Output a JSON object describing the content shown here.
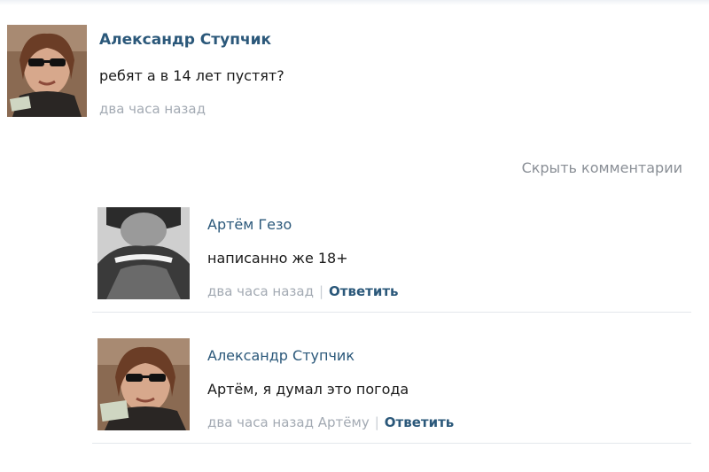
{
  "post": {
    "author": "Александр Ступчик",
    "text": "ребят а в 14 лет пустят?",
    "time": "два часа назад"
  },
  "hide_comments_label": "Скрыть комментарии",
  "replies": [
    {
      "author": "Артём Гезо",
      "text": "написанно же 18+",
      "time": "два часа назад",
      "reply_to": "",
      "answer_label": "Ответить"
    },
    {
      "author": "Александр Ступчик",
      "text": "Артём, я думал это погода",
      "time": "два часа назад",
      "reply_to": "Артёму",
      "answer_label": "Ответить"
    }
  ],
  "colors": {
    "link": "#2b587a",
    "muted": "#a3aab3"
  }
}
